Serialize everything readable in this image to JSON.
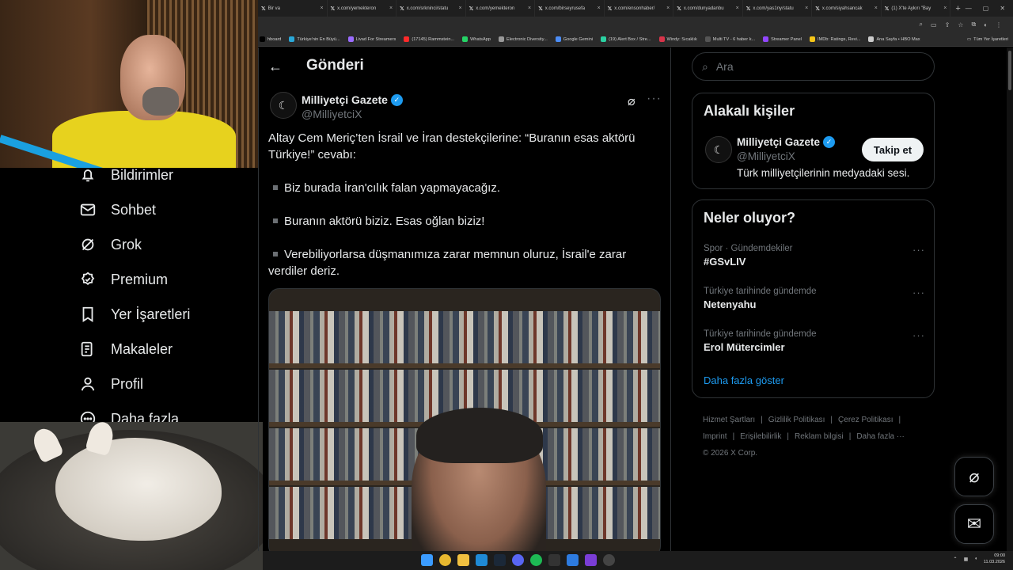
{
  "browser": {
    "tabs": [
      {
        "label": "Bir va"
      },
      {
        "label": "x.com/yemekteron"
      },
      {
        "label": "x.com/srkninci/statu"
      },
      {
        "label": "x.com/yemekteron"
      },
      {
        "label": "x.com/birseyrusefa"
      },
      {
        "label": "x.com/ensonhaber/"
      },
      {
        "label": "x.com/dunyadanbu"
      },
      {
        "label": "x.com/yas1ny/statu"
      },
      {
        "label": "x.com/siyahsancak"
      },
      {
        "label": "(1) X'te Aykırı \"Bay"
      }
    ],
    "new_tab": "+",
    "bookmarks": [
      {
        "label": "hboard",
        "color": "#000000"
      },
      {
        "label": "Türkiye'nin En Büyü...",
        "color": "#2aa8d8"
      },
      {
        "label": "Livad For Streamers",
        "color": "#9b6cff"
      },
      {
        "label": "(17145) Rammstein...",
        "color": "#ff2a2a"
      },
      {
        "label": "WhatsApp",
        "color": "#25d366"
      },
      {
        "label": "Electronic Diversity...",
        "color": "#999999"
      },
      {
        "label": "Google Gemini",
        "color": "#4c8df6"
      },
      {
        "label": "(19) Alert Box / Stre...",
        "color": "#2bd1a2"
      },
      {
        "label": "Windy: Sıcaklık",
        "color": "#d8344a"
      },
      {
        "label": "Multi TV - 6 haber k...",
        "color": "#555555"
      },
      {
        "label": "Streamer Panel",
        "color": "#9146ff"
      },
      {
        "label": "IMDb: Ratings, Revi...",
        "color": "#f5c518"
      },
      {
        "label": "Ana Sayfa • HBO Max",
        "color": "#cccccc"
      }
    ],
    "all_bookmarks": "Tüm Yer İşaretleri"
  },
  "nav": {
    "items": [
      {
        "label": "Bildirimler",
        "icon": "bell-icon"
      },
      {
        "label": "Sohbet",
        "icon": "mail-icon"
      },
      {
        "label": "Grok",
        "icon": "grok-icon"
      },
      {
        "label": "Premium",
        "icon": "premium-icon"
      },
      {
        "label": "Yer İşaretleri",
        "icon": "bookmark-icon"
      },
      {
        "label": "Makaleler",
        "icon": "article-icon"
      },
      {
        "label": "Profil",
        "icon": "person-icon"
      },
      {
        "label": "Daha fazla",
        "icon": "more-icon"
      }
    ]
  },
  "main": {
    "back_icon": "←",
    "title": "Gönderi",
    "author": {
      "name": "Milliyetçi Gazete",
      "handle": "@MilliyetciX",
      "verified_mark": "✓"
    },
    "post": {
      "paragraphs": [
        {
          "text": "Altay Cem Meriç’ten İsrail ve İran destekçilerine: “Buranın esas aktörü Türkiye!” cevabı:",
          "bullet": false
        },
        {
          "text": "Biz burada İran'cılık falan yapmayacağız.",
          "bullet": true
        },
        {
          "text": "Buranın aktörü biziz. Esas oğlan biziz!",
          "bullet": true
        },
        {
          "text": "Verebiliyorlarsa düşmanımıza zarar memnun oluruz, İsrail'e zarar verdiler deriz.",
          "bullet": true
        }
      ]
    }
  },
  "sidebar": {
    "search_placeholder": "Ara",
    "related": {
      "title": "Alakalı kişiler",
      "name": "Milliyetçi Gazete",
      "handle": "@MilliyetciX",
      "follow_label": "Takip et",
      "bio": "Türk milliyetçilerinin medyadaki sesi."
    },
    "trends": {
      "title": "Neler oluyor?",
      "items": [
        {
          "context": "Spor · Gündemdekiler",
          "name": "#GSvLIV"
        },
        {
          "context": "Türkiye tarihinde gündemde",
          "name": "Netenyahu"
        },
        {
          "context": "Türkiye tarihinde gündemde",
          "name": "Erol Mütercimler"
        }
      ],
      "show_more": "Daha fazla göster"
    },
    "footer": {
      "links": [
        "Hizmet Şartları",
        "Gizlilik Politikası",
        "Çerez Politikası",
        "Imprint",
        "Erişilebilirlik",
        "Reklam bilgisi",
        "Daha fazla ···"
      ],
      "copyright": "© 2026 X Corp."
    }
  },
  "taskbar": {
    "time": "09:00",
    "date": "11.03.2026"
  },
  "colors": {
    "accent": "#1d9bf0",
    "background": "#000000",
    "border": "#2f3336",
    "muted": "#71767b"
  }
}
